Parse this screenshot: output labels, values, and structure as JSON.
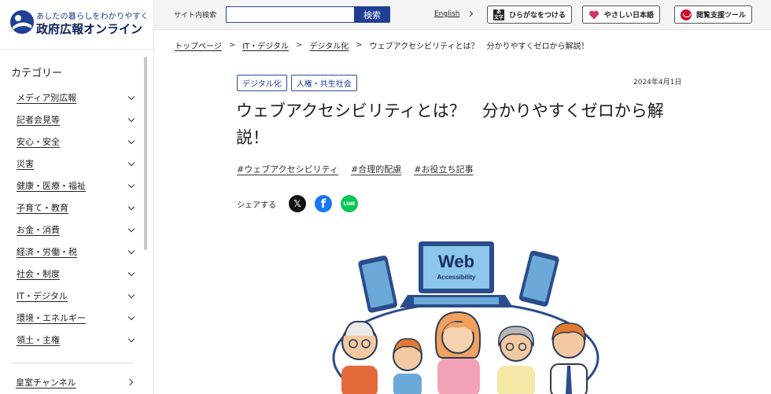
{
  "logo": {
    "tagline": "あしたの暮らしをわかりやすく",
    "name": "政府広報オンライン"
  },
  "sidebar": {
    "heading": "カテゴリー",
    "items": [
      {
        "label": "メディア別広報"
      },
      {
        "label": "記者会見等"
      },
      {
        "label": "安心・安全"
      },
      {
        "label": "災害"
      },
      {
        "label": "健康・医療・福祉"
      },
      {
        "label": "子育て・教育"
      },
      {
        "label": "お金・消費"
      },
      {
        "label": "経済・労働・税"
      },
      {
        "label": "社会・制度"
      },
      {
        "label": "IT・デジタル"
      },
      {
        "label": "環境・エネルギー"
      },
      {
        "label": "領土・主権"
      }
    ],
    "extra_link": "皇室チャンネル"
  },
  "header": {
    "search_label": "サイト内検索",
    "search_value": "",
    "search_button": "検索",
    "english_link": "English",
    "hiragana_button": "ひらがなをつける",
    "kana_icon_text": "あ\n文字",
    "easy_japanese_button": "やさしい日本語",
    "reading_tool_button": "閲覧支援ツール"
  },
  "breadcrumb": [
    "トップページ",
    "IT・デジタル",
    "デジタル化",
    "ウェブアクセシビリティとは？　分かりやすくゼロから解説！"
  ],
  "breadcrumb_separator": ">",
  "article": {
    "tags": [
      "デジタル化",
      "人権・共生社会"
    ],
    "date": "2024年4月1日",
    "title": "ウェブアクセシビリティとは？　分かりやすくゼロから解説！",
    "hashtags": [
      "#ウェブアクセシビリティ",
      "#合理的配慮",
      "#お役立ち記事"
    ],
    "share_label": "シェアする",
    "share_icons": [
      "x-icon",
      "facebook-icon",
      "line-icon"
    ],
    "line_icon_text": "LINE",
    "illustration": {
      "screen_title": "Web",
      "screen_subtitle": "Accessibility"
    }
  },
  "colors": {
    "brand_navy": "#1f3f96",
    "header_bg": "#f4f4f4",
    "facebook": "#1877f2",
    "line": "#06c755",
    "heart": "#d6336c",
    "tool": "#c8102e"
  }
}
